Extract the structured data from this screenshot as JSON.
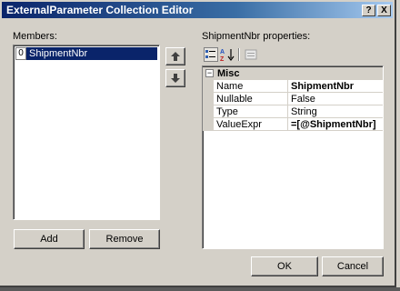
{
  "window": {
    "title": "ExternalParameter Collection Editor",
    "help_button": "?",
    "close_button": "X"
  },
  "members": {
    "label": "Members:",
    "items": [
      {
        "index": "0",
        "name": "ShipmentNbr"
      }
    ],
    "add_label": "Add",
    "remove_label": "Remove"
  },
  "properties": {
    "label": "ShipmentNbr properties:",
    "category": "Misc",
    "collapse_glyph": "−",
    "rows": [
      {
        "name": "Name",
        "value": "ShipmentNbr",
        "bold": true
      },
      {
        "name": "Nullable",
        "value": "False",
        "bold": false
      },
      {
        "name": "Type",
        "value": "String",
        "bold": false
      },
      {
        "name": "ValueExpr",
        "value": "=[@ShipmentNbr]",
        "bold": true
      }
    ]
  },
  "footer": {
    "ok_label": "OK",
    "cancel_label": "Cancel"
  },
  "colors": {
    "title_bar": "#0a246a",
    "selection": "#0a246a",
    "face": "#d4d0c8"
  }
}
